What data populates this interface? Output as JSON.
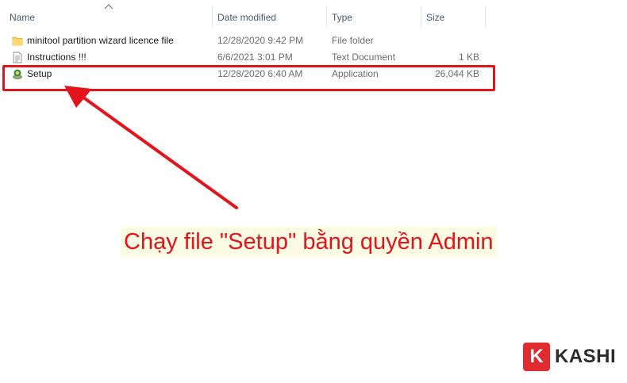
{
  "columns": {
    "name": "Name",
    "date_modified": "Date modified",
    "type": "Type",
    "size": "Size"
  },
  "files": [
    {
      "name": "minitool partition wizard licence file",
      "date": "12/28/2020 9:42 PM",
      "type": "File folder",
      "size": "",
      "icon": "folder-icon"
    },
    {
      "name": "Instructions !!!",
      "date": "6/6/2021 3:01 PM",
      "type": "Text Document",
      "size": "1 KB",
      "icon": "text-document-icon"
    },
    {
      "name": "Setup",
      "date": "12/28/2020 6:40 AM",
      "type": "Application",
      "size": "26,044 KB",
      "icon": "setup-application-icon"
    }
  ],
  "annotation": {
    "caption": "Chạy file \"Setup\" bằng quyền Admin",
    "color": "#e3141b"
  },
  "brand": {
    "badge_letter": "K",
    "name": "KASHI",
    "color": "#e02b2f"
  }
}
